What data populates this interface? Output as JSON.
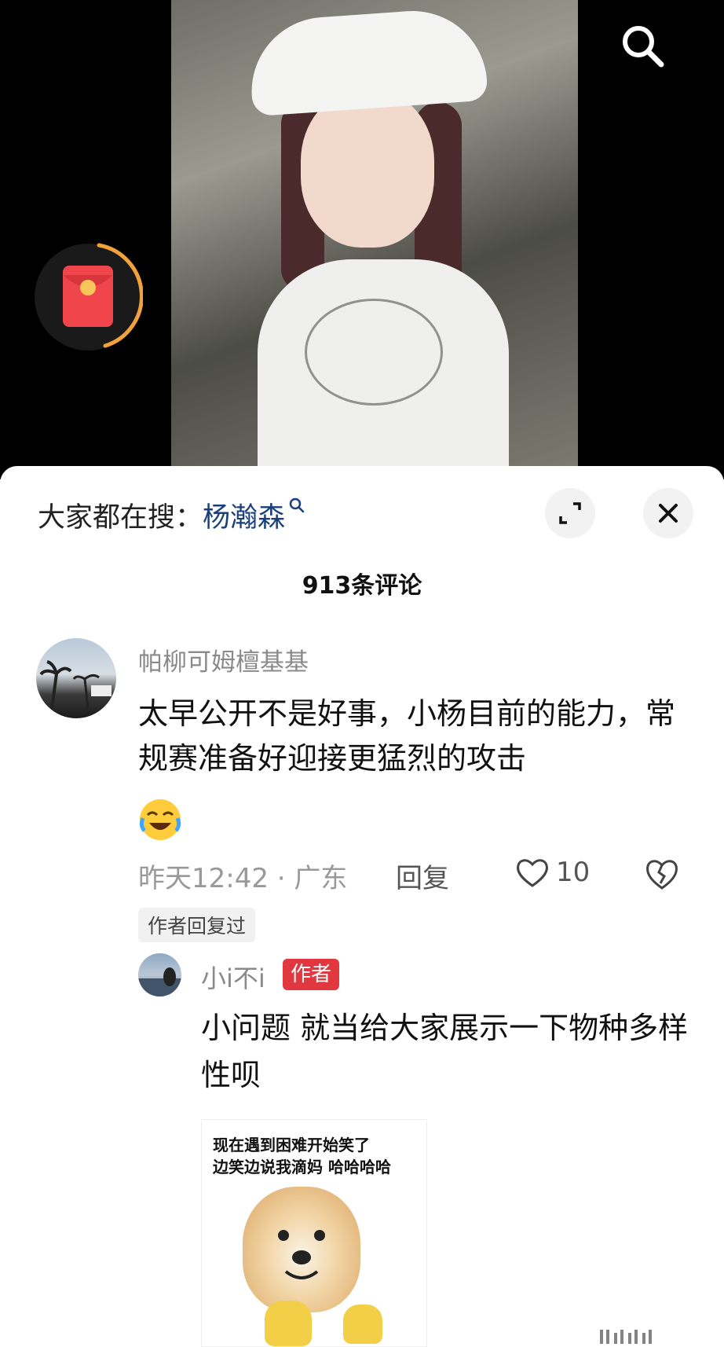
{
  "hot_search": {
    "prefix": "大家都在搜：",
    "keyword": "杨瀚森"
  },
  "comment_count": "913条评论",
  "comments": [
    {
      "username": "帕柳可姆檀基基",
      "text": "太早公开不是好事，小杨目前的能力，常规赛准备好迎接更猛烈的攻击",
      "emoji": "laughing-crying-emoji",
      "meta": "昨天12:42 · 广东",
      "reply_label": "回复",
      "likes": "10",
      "author_replied_tag": "作者回复过",
      "reply": {
        "username": "小i不i",
        "badge": "作者",
        "text": "小问题 就当给大家展示一下物种多样性呗",
        "meme": {
          "line1": "现在遇到困难开始笑了",
          "line2": "边笑边说我滴妈 哈哈哈哈"
        }
      }
    }
  ],
  "colors": {
    "keyword": "#1a3f7a",
    "badge": "#e0383e",
    "redpacket": "#f0454a",
    "progress_ring": "#f2a23a"
  },
  "icons": [
    "search-icon",
    "red-packet-icon",
    "expand-icon",
    "close-icon",
    "heart-icon",
    "broken-heart-icon"
  ]
}
